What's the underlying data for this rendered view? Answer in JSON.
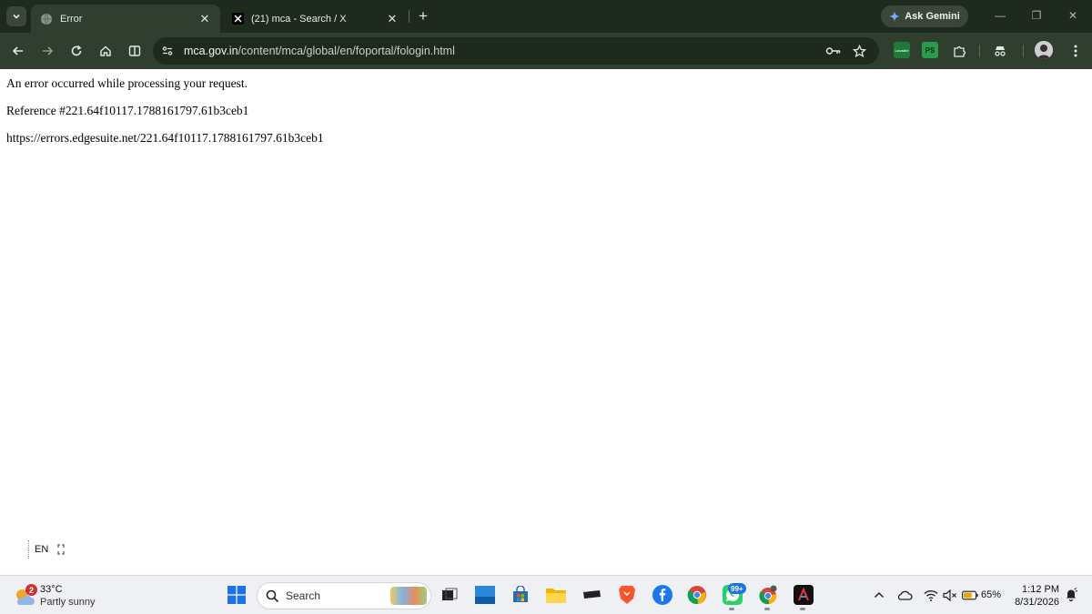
{
  "browser": {
    "tabs": [
      {
        "title": "Error",
        "active": true
      },
      {
        "title": "(21) mca - Search / X",
        "active": false
      }
    ],
    "new_tab_symbol": "+",
    "gemini_label": "Ask Gemini",
    "address": {
      "domain": "mca.gov.in",
      "path": "/content/mca/global/en/foportal/fologin.html"
    },
    "extensions": [
      "Lovable",
      "PS"
    ],
    "accent_color": "#2f3e2e"
  },
  "page": {
    "error_message": "An error occurred while processing your request.",
    "reference": "Reference #221.64f10117.1788161797.61b3ceb1",
    "error_url": "https://errors.edgesuite.net/221.64f10117.1788161797.61b3ceb1"
  },
  "input_indicator": {
    "language": "EN"
  },
  "taskbar": {
    "weather": {
      "badge": "2",
      "temperature": "33°C",
      "condition": "Partly sunny"
    },
    "search_label": "Search",
    "whatsapp_badge": "99+",
    "battery": "65%",
    "time": "1:12 PM",
    "date": "8/31/2026"
  }
}
